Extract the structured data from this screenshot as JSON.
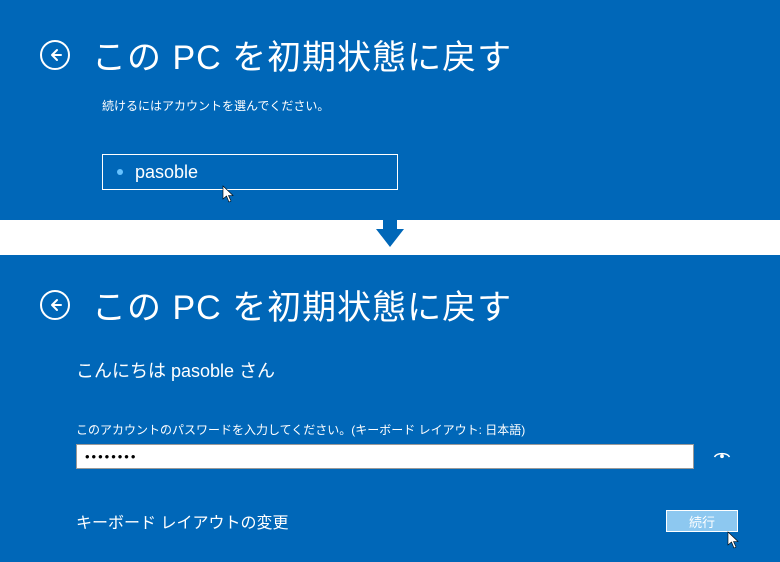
{
  "screen1": {
    "title": "この PC を初期状態に戻す",
    "subtext": "続けるにはアカウントを選んでください。",
    "account_name": "pasoble"
  },
  "screen2": {
    "title": "この PC を初期状態に戻す",
    "greeting": "こんにちは pasoble さん",
    "pwd_label": "このアカウントのパスワードを入力してください。(キーボード レイアウト: 日本語)",
    "pwd_value": "••••••••",
    "kb_change": "キーボード レイアウトの変更",
    "continue_label": "続行"
  }
}
